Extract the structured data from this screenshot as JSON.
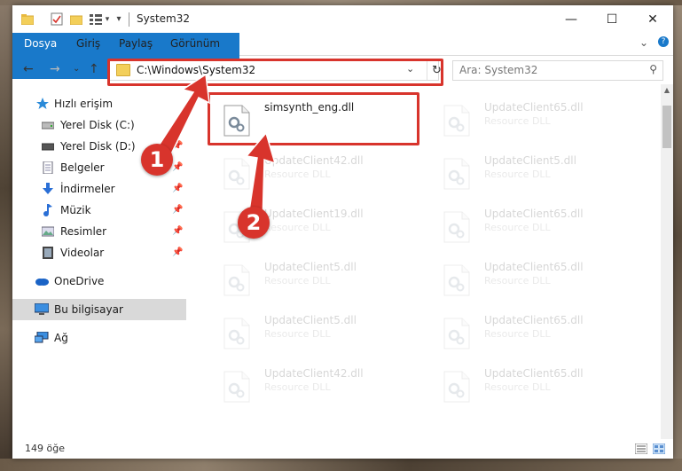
{
  "window": {
    "title": "System32",
    "controls": {
      "minimize": "—",
      "maximize": "☐",
      "close": "✕"
    }
  },
  "ribbon": {
    "tabs": [
      "Dosya",
      "Giriş",
      "Paylaş",
      "Görünüm"
    ],
    "expand_icon": "⌄",
    "help_icon": "?"
  },
  "address": {
    "path": "C:\\Windows\\System32",
    "dropdown": "⌄",
    "refresh": "↻"
  },
  "search": {
    "placeholder": "Ara: System32",
    "icon": "⚲"
  },
  "nav": {
    "back": "←",
    "forward": "→",
    "recent": "⌄",
    "up": "↑"
  },
  "sidebar": {
    "items": [
      {
        "label": "Hızlı erişim",
        "icon": "star-icon"
      },
      {
        "label": "Yerel Disk (C:)",
        "icon": "drive-icon"
      },
      {
        "label": "Yerel Disk (D:)",
        "icon": "drive-icon"
      },
      {
        "label": "Belgeler",
        "icon": "documents-icon"
      },
      {
        "label": "İndirmeler",
        "icon": "download-icon"
      },
      {
        "label": "Müzik",
        "icon": "music-icon"
      },
      {
        "label": "Resimler",
        "icon": "pictures-icon"
      },
      {
        "label": "Videolar",
        "icon": "videos-icon"
      },
      {
        "label": "OneDrive",
        "icon": "cloud-icon"
      },
      {
        "label": "Bu bilgisayar",
        "icon": "computer-icon"
      },
      {
        "label": "Ağ",
        "icon": "network-icon"
      }
    ],
    "pin": "📌"
  },
  "files": {
    "highlighted": {
      "name": "simsynth_eng.dll",
      "type": ""
    },
    "col1": [
      {
        "name": "UpdateClient42.dll",
        "type": "Resource DLL"
      },
      {
        "name": "UpdateClient19.dll",
        "type": "Resource DLL"
      },
      {
        "name": "UpdateClient5.dll",
        "type": "Resource DLL"
      },
      {
        "name": "UpdateClient5.dll",
        "type": "Resource DLL"
      },
      {
        "name": "UpdateClient42.dll",
        "type": "Resource DLL"
      }
    ],
    "col2": [
      {
        "name": "UpdateClient65.dll",
        "type": "Resource DLL"
      },
      {
        "name": "UpdateClient5.dll",
        "type": "Resource DLL"
      },
      {
        "name": "UpdateClient65.dll",
        "type": "Resource DLL"
      },
      {
        "name": "UpdateClient65.dll",
        "type": "Resource DLL"
      },
      {
        "name": "UpdateClient65.dll",
        "type": "Resource DLL"
      },
      {
        "name": "UpdateClient65.dll",
        "type": "Resource DLL"
      }
    ]
  },
  "status": {
    "count": "149 öğe"
  },
  "annotations": {
    "step1": "1",
    "step2": "2",
    "color": "#d8342c"
  }
}
